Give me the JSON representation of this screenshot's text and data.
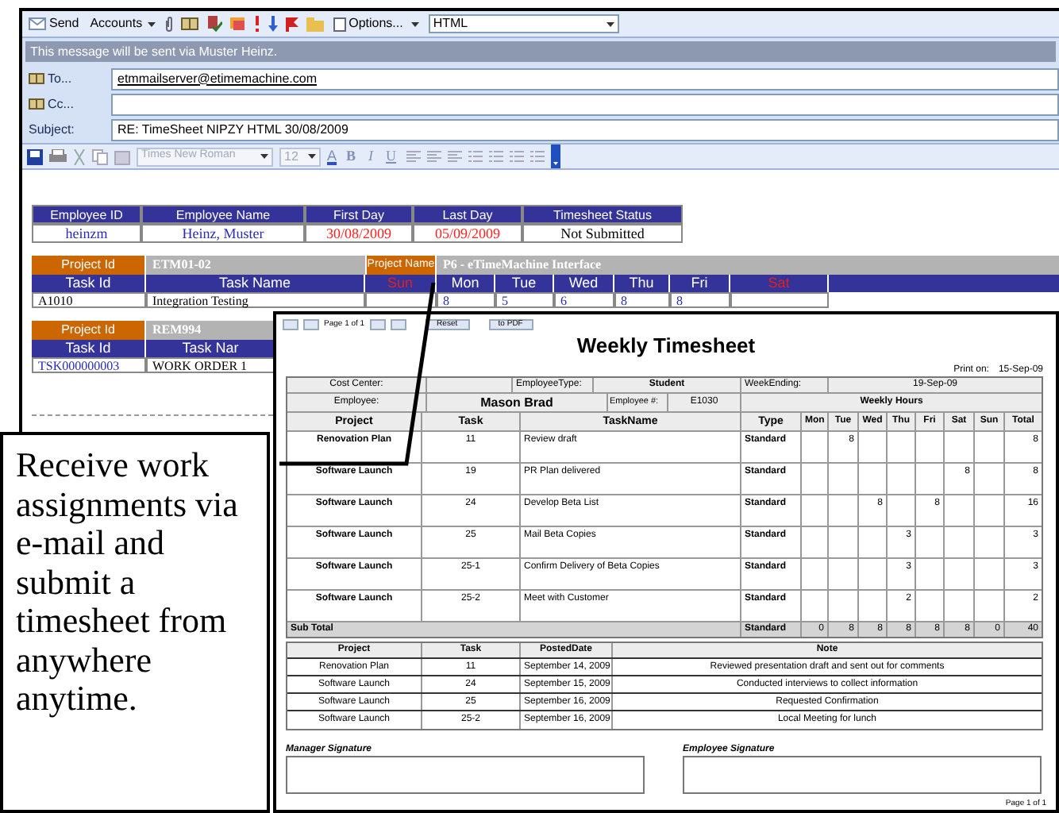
{
  "email_window": {
    "toolbar": {
      "send": "Send",
      "accounts": "Accounts",
      "options": "Options...",
      "format": "HTML"
    },
    "info_bar": "This message will be sent via  Muster Heinz.",
    "to": {
      "label": "To...",
      "value": "etmmailserver@etimemachine.com"
    },
    "cc": {
      "label": "Cc..."
    },
    "subject": {
      "label": "Subject:",
      "value": "RE: TimeSheet NIPZY HTML 30/08/2009"
    },
    "format_toolbar": {
      "font": "Times New Roman",
      "size": "12",
      "color_button": "A",
      "style_buttons": [
        "B",
        "I",
        "U"
      ]
    },
    "employee_table": {
      "columns": [
        "Employee ID",
        "Employee Name",
        "First Day",
        "Last Day",
        "Timesheet Status"
      ],
      "row": [
        {
          "text": "heinzm",
          "color": "#2a2ab0"
        },
        {
          "text": "Heinz, Muster",
          "color": "#2a2ab0"
        },
        {
          "text": "30/08/2009",
          "color": "#ff2020"
        },
        {
          "text": "05/09/2009",
          "color": "#ff2020"
        },
        {
          "text": "Not Submitted",
          "color": "#000000"
        }
      ]
    },
    "projects": [
      {
        "id_label": "Project Id",
        "id": "ETM01-02",
        "name_label": "Project Name",
        "name": "P6 - eTimeMachine Interface",
        "task_id_label": "Task Id",
        "task_name_label": "Task Name",
        "days": [
          {
            "label": "Sun",
            "weekend": true
          },
          {
            "label": "Mon",
            "weekend": false
          },
          {
            "label": "Tue",
            "weekend": false
          },
          {
            "label": "Wed",
            "weekend": false
          },
          {
            "label": "Thu",
            "weekend": false
          },
          {
            "label": "Fri",
            "weekend": false
          },
          {
            "label": "Sat",
            "weekend": true
          }
        ],
        "tasks": [
          {
            "id": "A1010",
            "name": "Integration Testing",
            "hours": {
              "mon": "8",
              "tue": "5",
              "wed": "6",
              "thu": "8",
              "fri": "8"
            }
          }
        ]
      },
      {
        "id_label": "Project Id",
        "id": "REM994",
        "task_id_label": "Task Id",
        "task_name_label": "Task Nar",
        "tasks": [
          {
            "id": "TSK000000003",
            "name": "WORK ORDER 1"
          }
        ]
      }
    ]
  },
  "report": {
    "page_label": "Page 1 of 1",
    "buttons": [
      "Reset",
      "to PDF"
    ],
    "title": "Weekly Timesheet",
    "print_on": {
      "label": "Print on:",
      "value": "15-Sep-09"
    },
    "info": {
      "cost_center_label": "Cost Center:",
      "employee_type_label": "EmployeeType:",
      "employee_type": "Student",
      "week_ending_label": "WeekEnding:",
      "week_ending": "19-Sep-09",
      "employee_label": "Employee:",
      "employee": "Mason Brad",
      "employee_no_label": "Employee #:",
      "employee_no": "E1030",
      "weekly_hours_label": "Weekly Hours"
    },
    "columns": [
      "Project",
      "Task",
      "TaskName",
      "Type",
      "Mon",
      "Tue",
      "Wed",
      "Thu",
      "Fri",
      "Sat",
      "Sun",
      "Total"
    ],
    "rows": [
      {
        "project": "Renovation Plan",
        "task": "11",
        "task_name": "Review draft",
        "type": "Standard",
        "hours": {
          "tue": "8"
        },
        "total": "8"
      },
      {
        "project": "Software Launch",
        "task": "19",
        "task_name": "PR Plan delivered",
        "type": "Standard",
        "hours": {
          "sat": "8"
        },
        "total": "8"
      },
      {
        "project": "Software Launch",
        "task": "24",
        "task_name": "Develop Beta List",
        "type": "Standard",
        "hours": {
          "wed": "8",
          "fri": "8"
        },
        "total": "16"
      },
      {
        "project": "Software Launch",
        "task": "25",
        "task_name": "Mail Beta Copies",
        "type": "Standard",
        "hours": {
          "thu": "3"
        },
        "total": "3"
      },
      {
        "project": "Software Launch",
        "task": "25-1",
        "task_name": "Confirm Delivery of Beta Copies",
        "type": "Standard",
        "hours": {
          "thu": "3"
        },
        "total": "3"
      },
      {
        "project": "Software Launch",
        "task": "25-2",
        "task_name": "Meet with Customer",
        "type": "Standard",
        "hours": {
          "thu": "2"
        },
        "total": "2"
      }
    ],
    "subtotal": {
      "label": "Sub Total",
      "type": "Standard",
      "hours": {
        "mon": "0",
        "tue": "8",
        "wed": "8",
        "thu": "8",
        "fri": "8",
        "sat": "8",
        "sun": "0"
      },
      "total": "40"
    },
    "notes": {
      "columns": [
        "Project",
        "Task",
        "PostedDate",
        "Note"
      ],
      "rows": [
        [
          "Renovation Plan",
          "11",
          "September 14, 2009",
          "Reviewed presentation draft and sent out for comments"
        ],
        [
          "Software Launch",
          "24",
          "September 15, 2009",
          "Conducted interviews to collect information"
        ],
        [
          "Software Launch",
          "25",
          "September 16, 2009",
          "Requested Confirmation"
        ],
        [
          "Software Launch",
          "25-2",
          "September 16, 2009",
          "Local Meeting for lunch"
        ]
      ]
    },
    "signatures": [
      "Manager Signature",
      "Employee Signature"
    ],
    "footer": "Page 1 of 1"
  },
  "callout": "Receive work assignments via e-mail and submit a timesheet from anywhere anytime."
}
